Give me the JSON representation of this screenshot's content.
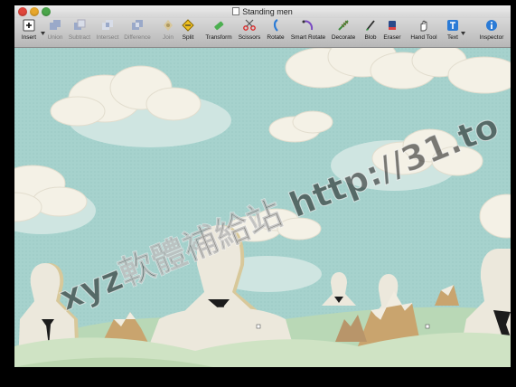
{
  "window": {
    "title": "Standing men"
  },
  "toolbar": {
    "tools": [
      {
        "id": "insert",
        "label": "Insert",
        "icon": "insert-icon",
        "enabled": true
      },
      {
        "id": "union",
        "label": "Union",
        "icon": "union-icon",
        "enabled": false
      },
      {
        "id": "subtract",
        "label": "Subtract",
        "icon": "subtract-icon",
        "enabled": false
      },
      {
        "id": "intersect",
        "label": "Intersect",
        "icon": "intersect-icon",
        "enabled": false
      },
      {
        "id": "difference",
        "label": "Difference",
        "icon": "difference-icon",
        "enabled": false
      },
      {
        "id": "join",
        "label": "Join",
        "icon": "join-icon",
        "enabled": false
      },
      {
        "id": "split",
        "label": "Split",
        "icon": "split-icon",
        "enabled": true
      },
      {
        "id": "transform",
        "label": "Transform",
        "icon": "transform-icon",
        "enabled": true
      },
      {
        "id": "scissors",
        "label": "Scissors",
        "icon": "scissors-icon",
        "enabled": true
      },
      {
        "id": "rotate",
        "label": "Rotate",
        "icon": "rotate-icon",
        "enabled": true
      },
      {
        "id": "smart_rotate",
        "label": "Smart Rotate",
        "icon": "smart-rotate-icon",
        "enabled": true
      },
      {
        "id": "decorate",
        "label": "Decorate",
        "icon": "decorate-icon",
        "enabled": true
      },
      {
        "id": "blob",
        "label": "Blob",
        "icon": "blob-icon",
        "enabled": true
      },
      {
        "id": "eraser",
        "label": "Eraser",
        "icon": "eraser-icon",
        "enabled": true
      },
      {
        "id": "hand",
        "label": "Hand Tool",
        "icon": "hand-icon",
        "enabled": true
      },
      {
        "id": "text",
        "label": "Text",
        "icon": "text-icon",
        "enabled": true
      },
      {
        "id": "inspector",
        "label": "Inspector",
        "icon": "inspector-icon",
        "enabled": true
      }
    ]
  },
  "watermark": {
    "text": "xyz軟體補給站 http://31.to"
  },
  "colors": {
    "sky": "#a6d2cd",
    "cloud": "#f4f1e6",
    "hill": "#cfe3c4",
    "figure": "#ece8dc",
    "tie": "#1c1c1c",
    "rock": "#c9a46e"
  }
}
